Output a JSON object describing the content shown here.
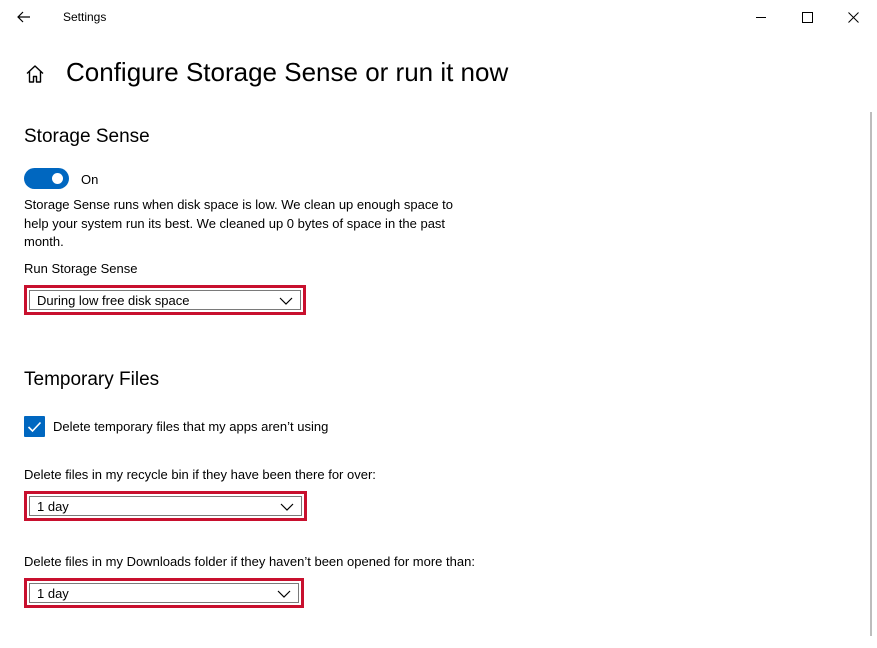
{
  "window": {
    "title": "Settings",
    "back_icon": "back-arrow-icon",
    "minimize_icon": "minimize-icon",
    "maximize_icon": "maximize-icon",
    "close_icon": "close-icon"
  },
  "header": {
    "home_icon": "home-icon",
    "title": "Configure Storage Sense or run it now"
  },
  "storage_sense": {
    "heading": "Storage Sense",
    "toggle_state": "On",
    "description": "Storage Sense runs when disk space is low. We clean up enough space to help your system run its best. We cleaned up 0 bytes of space in the past month.",
    "run_label": "Run Storage Sense",
    "run_value": "During low free disk space"
  },
  "temporary_files": {
    "heading": "Temporary Files",
    "checkbox_label": "Delete temporary files that my apps aren’t using",
    "checkbox_checked": true,
    "recycle_label": "Delete files in my recycle bin if they have been there for over:",
    "recycle_value": "1 day",
    "downloads_label": "Delete files in my Downloads folder if they haven’t been opened for more than:",
    "downloads_value": "1 day"
  },
  "colors": {
    "accent": "#0067c0",
    "highlight_border": "#c8102e"
  }
}
